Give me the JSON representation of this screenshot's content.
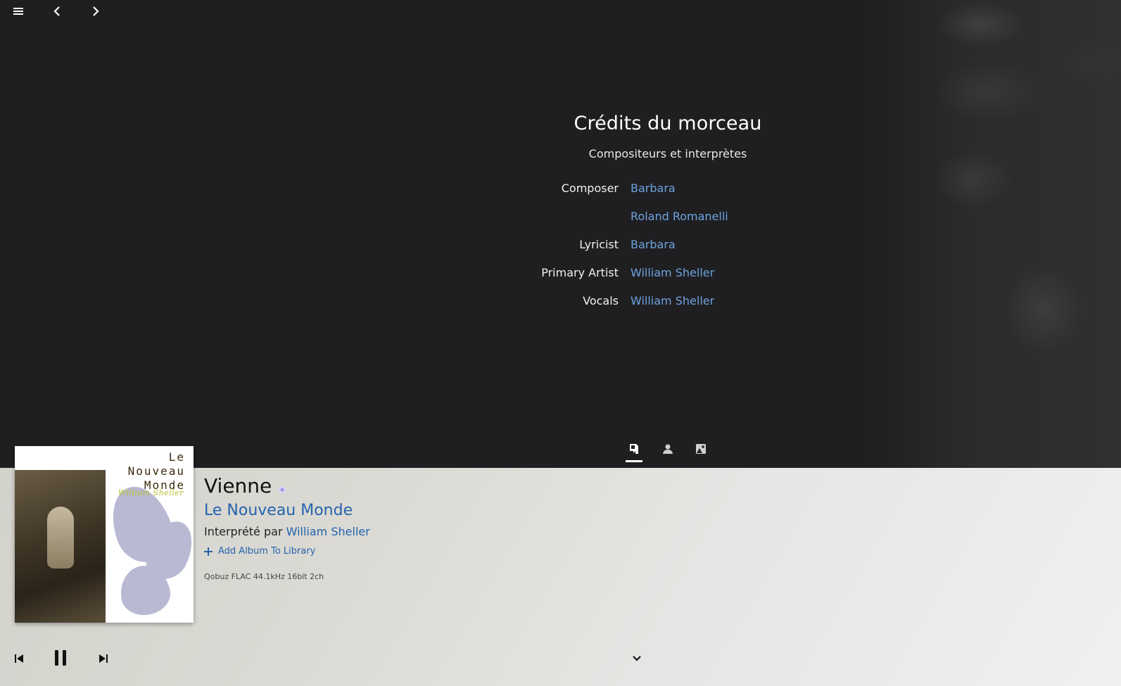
{
  "nav": {
    "menu_icon": "hamburger-icon",
    "back_icon": "chevron-left-icon",
    "forward_icon": "chevron-right-icon"
  },
  "credits": {
    "title": "Crédits du morceau",
    "subtitle": "Compositeurs et interprètes",
    "rows": [
      {
        "role": "Composer",
        "name": "Barbara"
      },
      {
        "role": "",
        "name": "Roland Romanelli"
      },
      {
        "role": "Lyricist",
        "name": "Barbara"
      },
      {
        "role": "Primary Artist",
        "name": "William Sheller"
      },
      {
        "role": "Vocals",
        "name": "William Sheller"
      }
    ]
  },
  "tabs": [
    {
      "icon": "lyrics-icon",
      "active": true
    },
    {
      "icon": "artist-icon",
      "active": false
    },
    {
      "icon": "artwork-icon",
      "active": false
    }
  ],
  "cover": {
    "title_lines": "Le\nNouveau\nMonde",
    "artist": "William Sheller"
  },
  "now_playing": {
    "title": "Vienne",
    "album": "Le Nouveau Monde",
    "performed_prefix": "Interprété par",
    "artist": "William Sheller",
    "add_album_label": "Add Album To Library",
    "quality": "Qobuz FLAC 44.1kHz 16bit 2ch"
  },
  "controls": {
    "previous_icon": "skip-previous-icon",
    "pause_icon": "pause-icon",
    "next_icon": "skip-next-icon",
    "collapse_icon": "chevron-down-icon"
  },
  "colors": {
    "background": "#1f1f21",
    "link": "#6ea2e0",
    "link_light": "#2563ad"
  }
}
